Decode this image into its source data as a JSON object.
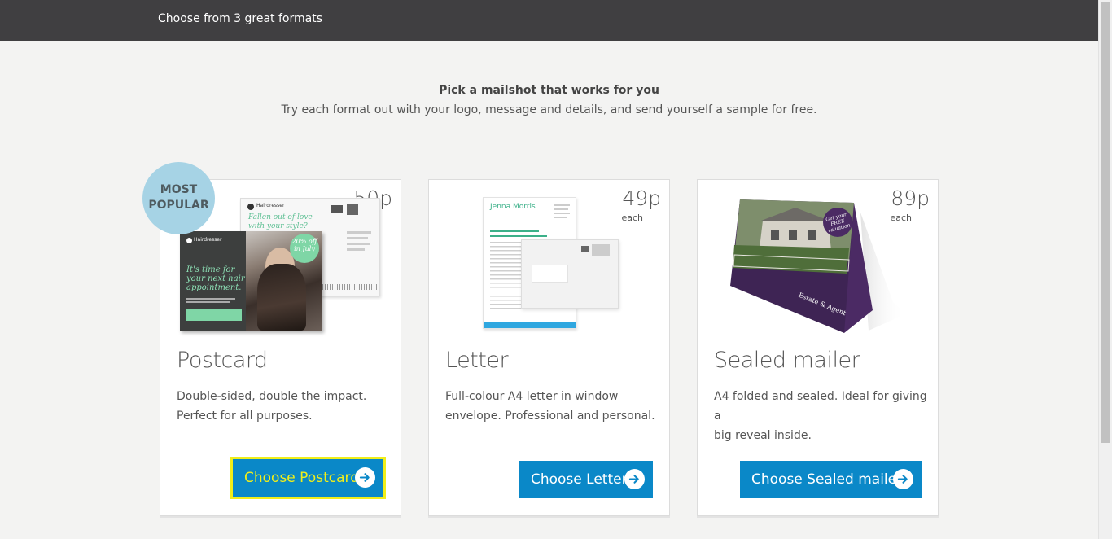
{
  "header": {
    "title": "Choose from 3 great formats"
  },
  "intro": {
    "heading": "Pick a mailshot that works for you",
    "subheading": "Try each format out with your logo, message and details, and send yourself a sample for free."
  },
  "badge": {
    "line1": "MOST",
    "line2": "POPULAR"
  },
  "cards": [
    {
      "title": "Postcard",
      "price": "50p",
      "each": "each",
      "desc_line1": "Double-sided, double the impact.",
      "desc_line2": "Perfect for all purposes.",
      "button": "Choose Postcard",
      "sample": {
        "brand": "Hairdresser",
        "headline": "It's time for your next hair appointment.",
        "back_headline": "Fallen out of love with your style?",
        "offer": "20% off in July"
      }
    },
    {
      "title": "Letter",
      "price": "49p",
      "each": "each",
      "desc_line1": "Full-colour A4 letter in window",
      "desc_line2": "envelope. Professional and personal.",
      "button": "Choose Letter",
      "sample": {
        "name": "Jenna Morris"
      }
    },
    {
      "title": "Sealed mailer",
      "price": "89p",
      "each": "each",
      "desc_line1": "A4 folded and sealed. Ideal for giving a",
      "desc_line2": "big reveal inside.",
      "button": "Choose Sealed mailer",
      "sample": {
        "tag": "Get your FREE valuation",
        "brand": "Estate & Agent"
      }
    }
  ],
  "colors": {
    "header_bg": "#403f41",
    "button_bg": "#0a88c8",
    "focus_outline": "#f0ee1a",
    "badge_bg": "#a6d3e5",
    "page_bg": "#f3f3f2"
  },
  "icons": {
    "button_arrow": "arrow-right-circle-icon"
  }
}
